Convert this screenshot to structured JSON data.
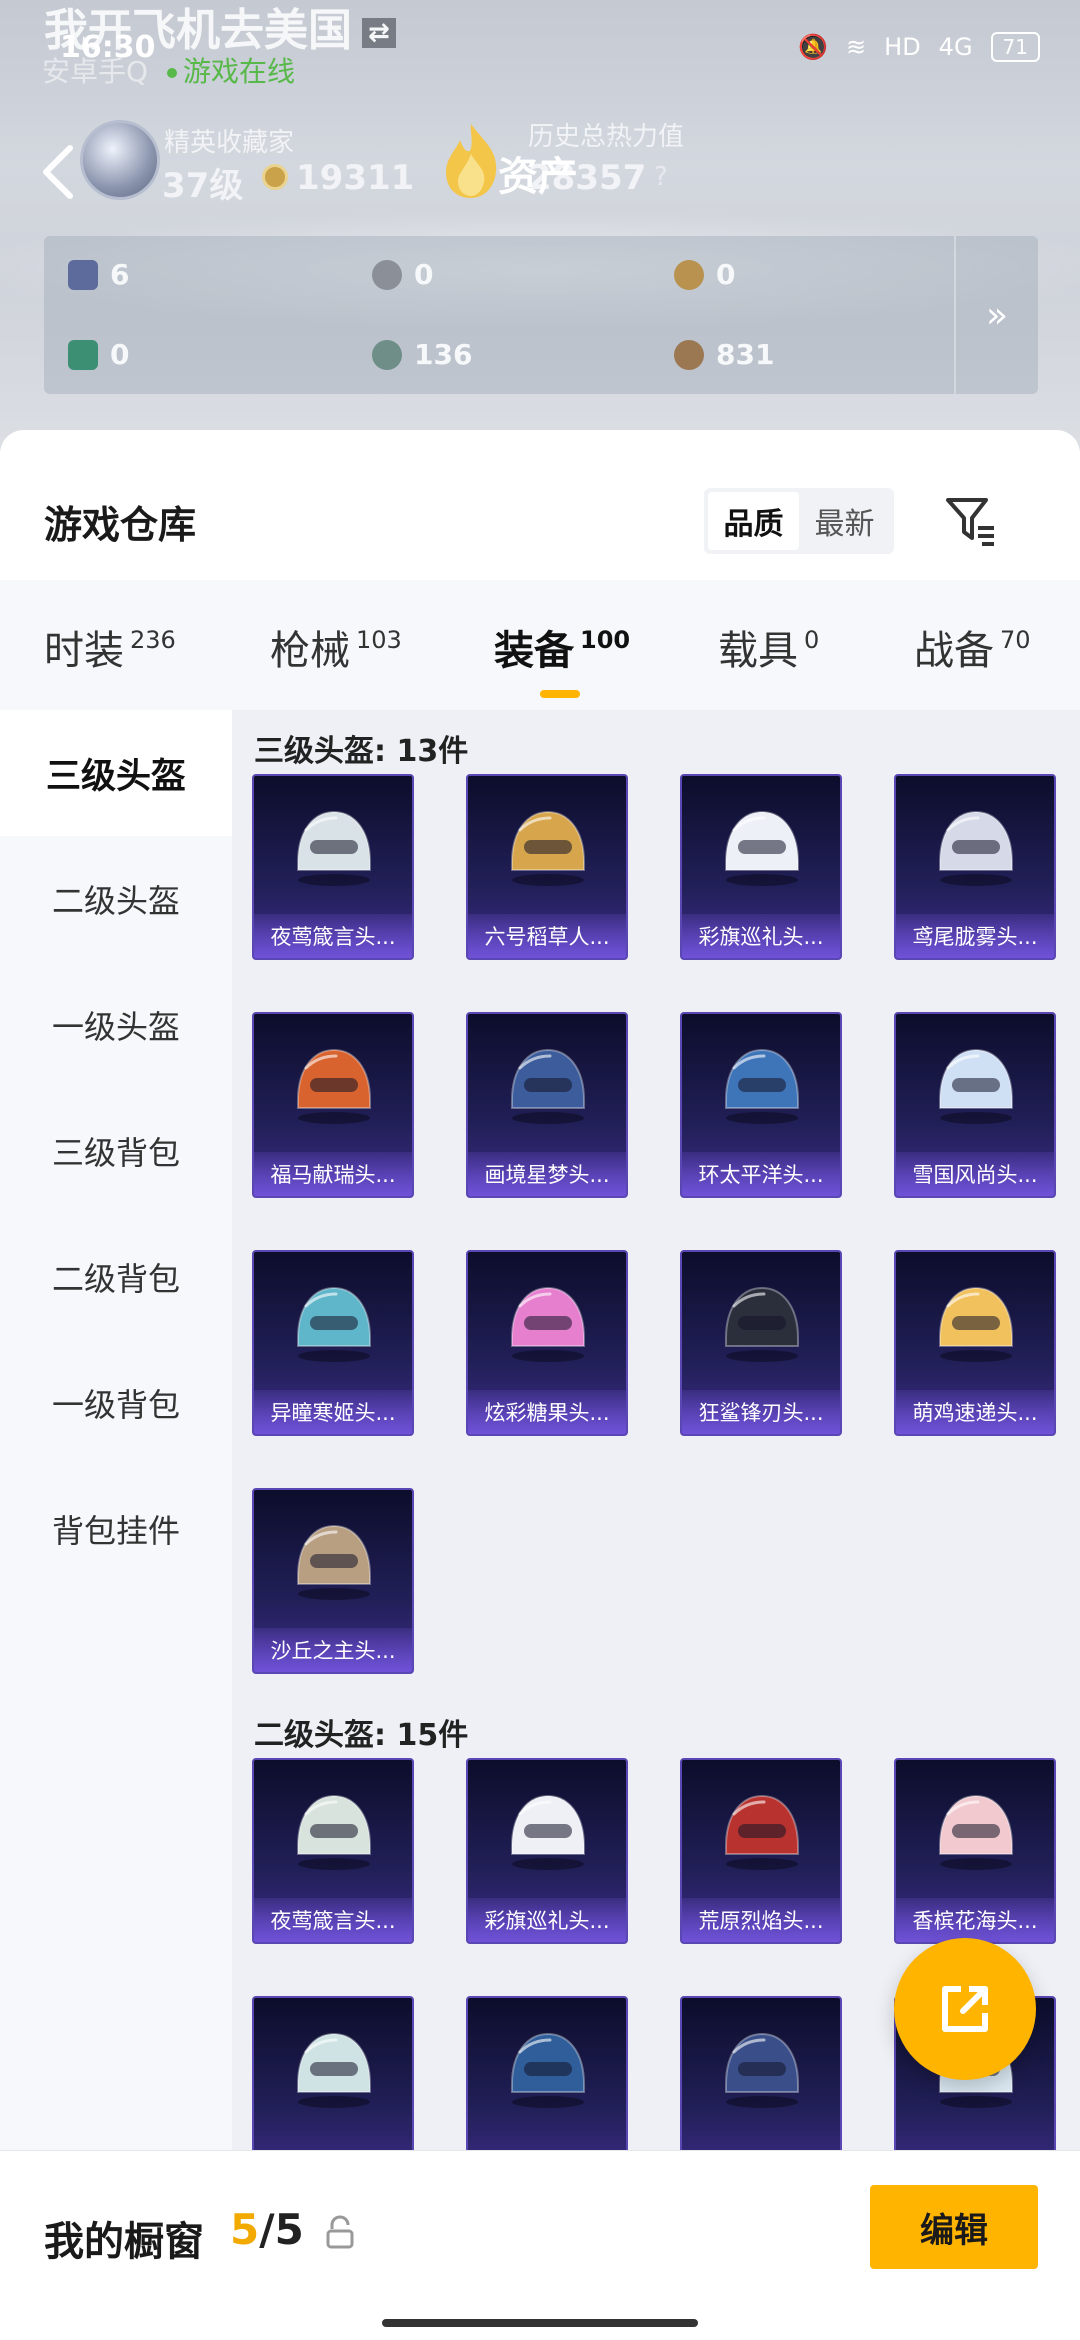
{
  "status_bar": {
    "time": "16:30",
    "battery": "71",
    "network": "4G",
    "hd": "HD"
  },
  "player": {
    "name": "我开飞机去美国",
    "platform": "安卓手Q",
    "status": "游戏在线",
    "rank_title": "精英收藏家",
    "level": "37级",
    "score": "19311",
    "heat_title": "历史总热力值",
    "heat_value": "28357",
    "heat_overlay": "资产",
    "heat_help": "?"
  },
  "stats": [
    {
      "icon": "card-icon",
      "value": "6",
      "color": "#5d6a9c"
    },
    {
      "icon": "coin-silver-icon",
      "value": "0",
      "color": "#8b8f98"
    },
    {
      "icon": "coin-gold-icon",
      "value": "0",
      "color": "#b8924e"
    },
    {
      "icon": "ticket-icon",
      "value": "0",
      "color": "#3d8f74"
    },
    {
      "icon": "gem-icon",
      "value": "136",
      "color": "#6e8e87"
    },
    {
      "icon": "medal-icon",
      "value": "831",
      "color": "#9b7852"
    }
  ],
  "stats_more": "»",
  "warehouse": {
    "title": "游戏仓库",
    "sort_options": [
      "品质",
      "最新"
    ],
    "sort_active": "品质"
  },
  "tabs": [
    {
      "label": "时装",
      "count": "236"
    },
    {
      "label": "枪械",
      "count": "103"
    },
    {
      "label": "装备",
      "count": "100"
    },
    {
      "label": "载具",
      "count": "0"
    },
    {
      "label": "战备",
      "count": "70"
    }
  ],
  "sidebar": [
    "三级头盔",
    "二级头盔",
    "一级头盔",
    "三级背包",
    "二级背包",
    "一级背包",
    "背包挂件"
  ],
  "sections": [
    {
      "title": "三级头盔: 13件",
      "items": [
        {
          "name": "夜莺箴言头...",
          "color": "#d9e2e6"
        },
        {
          "name": "六号稻草人...",
          "color": "#d7a54c"
        },
        {
          "name": "彩旗巡礼头...",
          "color": "#eef0f8"
        },
        {
          "name": "鸢尾胧雾头...",
          "color": "#d5d9e8"
        },
        {
          "name": "福马献瑞头...",
          "color": "#d8632f"
        },
        {
          "name": "画境星梦头...",
          "color": "#3c5c9c"
        },
        {
          "name": "环太平洋头...",
          "color": "#3e74b8"
        },
        {
          "name": "雪国风尚头...",
          "color": "#cfe0f5"
        },
        {
          "name": "异瞳寒姬头...",
          "color": "#5fb5c9"
        },
        {
          "name": "炫彩糖果头...",
          "color": "#e77fcf"
        },
        {
          "name": "狂鲨锋刃头...",
          "color": "#2b2f3c"
        },
        {
          "name": "萌鸡速递头...",
          "color": "#f1c15d"
        },
        {
          "name": "沙丘之主头...",
          "color": "#b89f82"
        }
      ]
    },
    {
      "title": "二级头盔: 15件",
      "items": [
        {
          "name": "夜莺箴言头...",
          "color": "#d7e3dc"
        },
        {
          "name": "彩旗巡礼头...",
          "color": "#eef0f6"
        },
        {
          "name": "荒原烈焰头...",
          "color": "#b8332f"
        },
        {
          "name": "香槟花海头...",
          "color": "#f1c9cf"
        },
        {
          "name": "",
          "color": "#cfe3e5"
        },
        {
          "name": "",
          "color": "#2f5e9a"
        },
        {
          "name": "",
          "color": "#3a4f8a"
        },
        {
          "name": "",
          "color": "#dbe8f2"
        }
      ]
    }
  ],
  "showcase": {
    "title": "我的橱窗",
    "current": "5",
    "total": "/5",
    "edit_label": "编辑"
  }
}
